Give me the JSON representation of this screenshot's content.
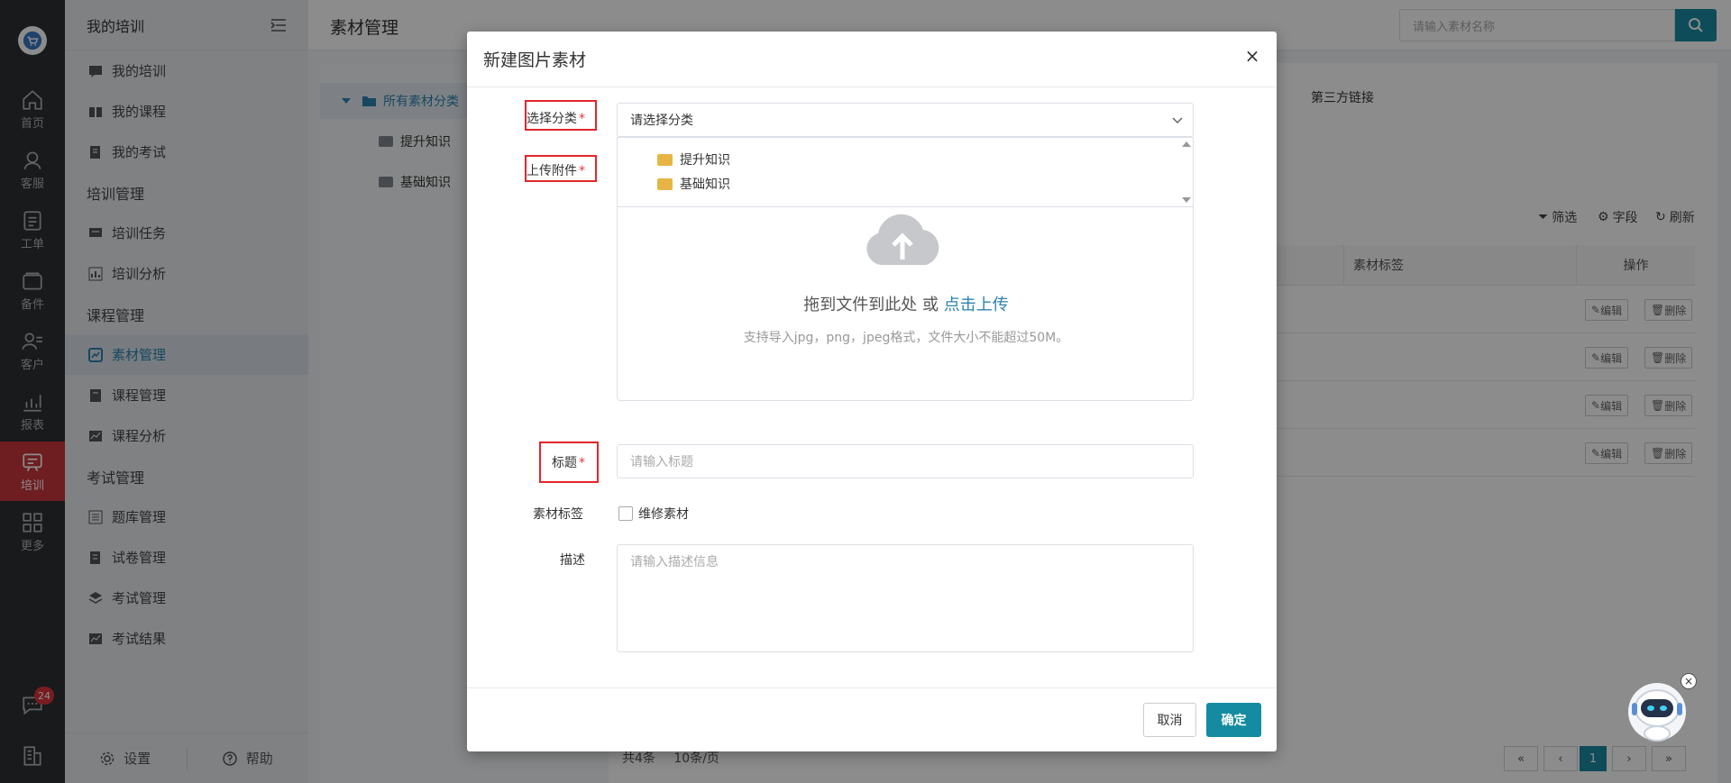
{
  "rail": {
    "items": [
      {
        "label": "首页",
        "icon": "home-icon"
      },
      {
        "label": "客服",
        "icon": "headset-icon"
      },
      {
        "label": "工单",
        "icon": "clipboard-icon"
      },
      {
        "label": "备件",
        "icon": "wallet-icon"
      },
      {
        "label": "客户",
        "icon": "user-list-icon"
      },
      {
        "label": "报表",
        "icon": "chart-icon"
      },
      {
        "label": "培训",
        "icon": "training-chat-icon",
        "active": true
      },
      {
        "label": "更多",
        "icon": "grid-icon"
      }
    ],
    "badge": "24"
  },
  "subnav": {
    "title": "我的培训",
    "items": [
      {
        "type": "link",
        "label": "我的培训"
      },
      {
        "type": "link",
        "label": "我的课程"
      },
      {
        "type": "link",
        "label": "我的考试"
      },
      {
        "type": "group",
        "label": "培训管理"
      },
      {
        "type": "link",
        "label": "培训任务"
      },
      {
        "type": "link",
        "label": "培训分析"
      },
      {
        "type": "group",
        "label": "课程管理"
      },
      {
        "type": "link",
        "label": "素材管理",
        "active": true
      },
      {
        "type": "link",
        "label": "课程管理"
      },
      {
        "type": "link",
        "label": "课程分析"
      },
      {
        "type": "group",
        "label": "考试管理"
      },
      {
        "type": "link",
        "label": "题库管理"
      },
      {
        "type": "link",
        "label": "试卷管理"
      },
      {
        "type": "link",
        "label": "考试管理"
      },
      {
        "type": "link",
        "label": "考试结果"
      }
    ],
    "footer": {
      "settings": "设置",
      "help": "帮助"
    }
  },
  "main": {
    "title": "素材管理",
    "search_placeholder": "请输入素材名称",
    "tree": {
      "root": "所有素材分类",
      "children": [
        "提升知识",
        "基础知识"
      ]
    },
    "third_party_link": "第三方链接",
    "toolbar": {
      "filter": "筛选",
      "fields": "字段",
      "refresh": "刷新"
    },
    "table": {
      "headers": {
        "tag": "素材标签",
        "actions": "操作"
      },
      "row_count": 4,
      "edit": "编辑",
      "delete": "删除"
    },
    "pager": {
      "total": "共4条",
      "per_page": "10条/页",
      "current": "1"
    }
  },
  "dialog": {
    "title": "新建图片素材",
    "close": "×",
    "category": {
      "label": "选择分类",
      "required": "*",
      "value": "请选择分类",
      "options": [
        "提升知识",
        "基础知识"
      ]
    },
    "upload": {
      "label": "上传附件",
      "required": "*",
      "text": "拖到文件到此处 或 ",
      "link": "点击上传",
      "hint": "支持导入jpg，png，jpeg格式，文件大小不能超过50M。"
    },
    "title_field": {
      "label": "标题",
      "required": "*",
      "placeholder": "请输入标题"
    },
    "tag_field": {
      "label": "素材标签",
      "option": "维修素材"
    },
    "desc_field": {
      "label": "描述",
      "placeholder": "请输入描述信息"
    },
    "cancel": "取消",
    "ok": "确定"
  },
  "colors": {
    "accent": "#158ba1",
    "rail": "#2f3134",
    "active_rail": "#c8363b",
    "highlight": "#e2262c"
  }
}
